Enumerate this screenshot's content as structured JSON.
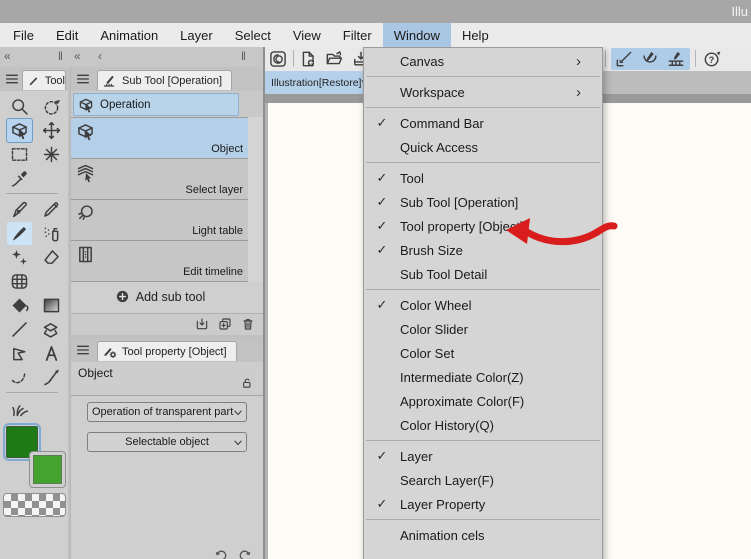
{
  "titlebar": {
    "title": "Illu"
  },
  "menu_bar": {
    "items": [
      "File",
      "Edit",
      "Animation",
      "Layer",
      "Select",
      "View",
      "Filter",
      "Window",
      "Help"
    ],
    "active": "Window"
  },
  "window_menu": {
    "items": [
      {
        "label": "Canvas",
        "submenu": true
      },
      {
        "sep": true
      },
      {
        "label": "Workspace",
        "submenu": true
      },
      {
        "sep": true
      },
      {
        "label": "Command Bar",
        "checked": true
      },
      {
        "label": "Quick Access"
      },
      {
        "sep": true
      },
      {
        "label": "Tool",
        "checked": true
      },
      {
        "label": "Sub Tool [Operation]",
        "checked": true
      },
      {
        "label": "Tool property [Object]",
        "checked": true,
        "annotated": true
      },
      {
        "label": "Brush Size",
        "checked": true
      },
      {
        "label": "Sub Tool Detail"
      },
      {
        "sep": true
      },
      {
        "label": "Color Wheel",
        "checked": true
      },
      {
        "label": "Color Slider"
      },
      {
        "label": "Color Set"
      },
      {
        "label": "Intermediate Color(Z)"
      },
      {
        "label": "Approximate Color(F)"
      },
      {
        "label": "Color History(Q)"
      },
      {
        "sep": true
      },
      {
        "label": "Layer",
        "checked": true
      },
      {
        "label": "Search Layer(F)"
      },
      {
        "label": "Layer Property",
        "checked": true
      },
      {
        "sep": true
      },
      {
        "label": "Animation cels"
      }
    ]
  },
  "annotation": {
    "type": "hand-drawn-arrow",
    "color": "#d91d1d",
    "points_to": "Tool property [Object]"
  },
  "document_tab": {
    "label": "Illustration[Restore]*"
  },
  "tool_panel": {
    "tab_label": "Tool",
    "selected_tool": "operation-tool",
    "highlighted_tool": "brush-tool",
    "rows": [
      [
        "zoom-tool",
        "rotate-tool"
      ],
      [
        "operation-tool",
        "move-tool"
      ],
      [
        "marquee-tool",
        "auto-select-tool"
      ],
      [
        "eyedropper-tool",
        null
      ],
      "sep",
      [
        "pen-tool",
        "pencil-tool"
      ],
      [
        "brush-tool",
        "airbrush-tool"
      ],
      [
        "decoration-tool",
        "eraser-tool"
      ],
      [
        "blend-tool",
        null
      ],
      [
        "fill-tool",
        "gradient-tool"
      ],
      [
        "line-tool",
        "figure-tool"
      ],
      [
        "polyline-tool",
        "text-tool"
      ],
      [
        "frame-border-tool",
        "correct-line-tool"
      ],
      "sep",
      [
        "grass-tool",
        null
      ]
    ]
  },
  "subtool_panel": {
    "tab_label": "Sub Tool [Operation]",
    "group_label": "Operation",
    "items": [
      {
        "label": "Object",
        "icon": "operation-tool",
        "selected": true
      },
      {
        "label": "Select layer",
        "icon": "select-layer"
      },
      {
        "label": "Light table",
        "icon": "light-table"
      },
      {
        "label": "Edit timeline",
        "icon": "edit-timeline"
      }
    ],
    "add_label": "Add sub tool"
  },
  "tool_property": {
    "tab_label": "Tool property [Object]",
    "tool_name": "Object",
    "dropdowns": [
      {
        "value": "Operation of transparent part"
      },
      {
        "value": "Selectable object"
      }
    ]
  },
  "colors": {
    "menu_highlight": "#a9c7e4",
    "selection_blue": "#b4cfe8",
    "arrow_red": "#d91d1d",
    "main_color": "#1d7a15",
    "sub_color": "#43a32e"
  },
  "icons": {
    "collapse-double": "«",
    "collapse-single": "‹",
    "panel-handle": "‖",
    "check": "✓",
    "submenu-arrow": "›"
  }
}
